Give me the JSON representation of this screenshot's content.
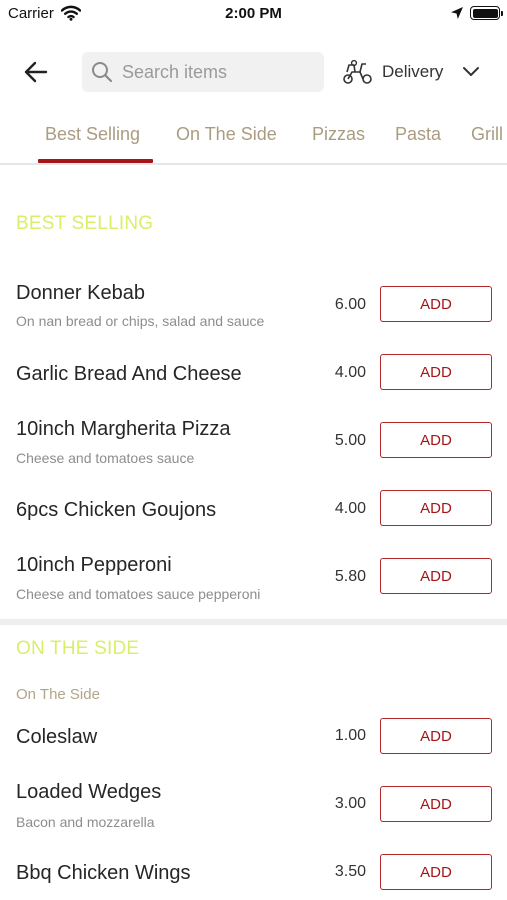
{
  "status_bar": {
    "carrier": "Carrier",
    "time": "2:00 PM"
  },
  "header": {
    "search_placeholder": "Search items",
    "delivery_label": "Delivery"
  },
  "tabs": [
    {
      "label": "Best Selling",
      "active": true
    },
    {
      "label": "On The Side",
      "active": false
    },
    {
      "label": "Pizzas",
      "active": false
    },
    {
      "label": "Pasta",
      "active": false
    },
    {
      "label": "Grill",
      "active": false
    }
  ],
  "sections": [
    {
      "heading": "BEST SELLING",
      "items": [
        {
          "name": "Donner Kebab",
          "desc": "On nan bread or chips, salad and sauce",
          "price": "6.00",
          "button": "ADD"
        },
        {
          "name": "Garlic Bread And Cheese",
          "desc": "",
          "price": "4.00",
          "button": "ADD"
        },
        {
          "name": "10inch Margherita Pizza",
          "desc": "Cheese and tomatoes sauce",
          "price": "5.00",
          "button": "ADD"
        },
        {
          "name": "6pcs Chicken Goujons",
          "desc": "",
          "price": "4.00",
          "button": "ADD"
        },
        {
          "name": "10inch Pepperoni",
          "desc": "Cheese and tomatoes sauce pepperoni",
          "price": "5.80",
          "button": "ADD"
        }
      ]
    },
    {
      "heading": "ON THE SIDE",
      "subheading": "On The Side",
      "items": [
        {
          "name": "Coleslaw",
          "desc": "",
          "price": "1.00",
          "button": "ADD"
        },
        {
          "name": "Loaded Wedges",
          "desc": "Bacon and mozzarella",
          "price": "3.00",
          "button": "ADD"
        },
        {
          "name": "Bbq Chicken Wings",
          "desc": "",
          "price": "3.50",
          "button": "ADD"
        }
      ]
    }
  ],
  "colors": {
    "accent": "#a4161a",
    "section_heading": "#d8ef6a",
    "tab_text": "#a99c81"
  }
}
